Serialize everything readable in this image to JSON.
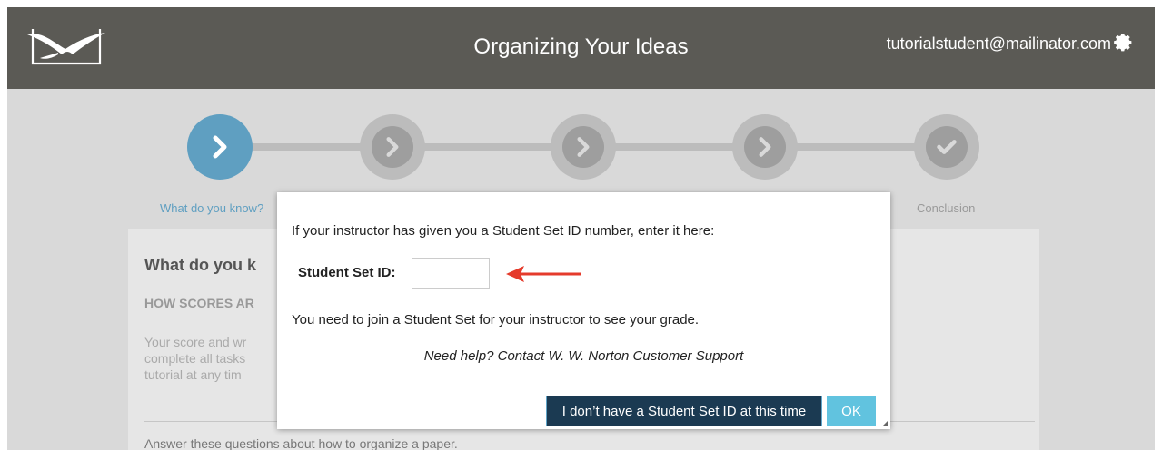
{
  "header": {
    "title": "Organizing Your Ideas",
    "user_email": "tutorialstudent@mailinator.com",
    "logo": "seagull-logo",
    "settings_icon": "gear-icon"
  },
  "progress": {
    "steps": [
      {
        "label": "What do you know?",
        "state": "active",
        "icon": "chevron-right-icon"
      },
      {
        "label": "",
        "state": "inactive",
        "icon": "chevron-right-icon"
      },
      {
        "label": "",
        "state": "inactive",
        "icon": "chevron-right-icon"
      },
      {
        "label": "",
        "state": "inactive",
        "icon": "chevron-right-icon"
      },
      {
        "label": "Conclusion",
        "state": "inactive",
        "icon": "check-icon"
      }
    ]
  },
  "card": {
    "heading": "What do you k",
    "subheading": "HOW SCORES AR",
    "body": "Your score and wr complete all tasks tutorial at any tim",
    "footer": "Answer these questions about how to organize a paper."
  },
  "modal": {
    "prompt": "If your instructor has given you a Student Set ID number, enter it here:",
    "field_label": "Student Set ID:",
    "field_value": "",
    "note": "You need to join a Student Set for your instructor to see your grade.",
    "help": "Need help? Contact W. W. Norton Customer Support",
    "no_id_button": "I don’t have a Student Set ID at this time",
    "ok_button": "OK"
  },
  "colors": {
    "header_bg": "#5b5a55",
    "active_step": "#5f9fc1",
    "primary_button": "#1b3a52",
    "ok_button": "#61c3df",
    "arrow": "#e53b2c"
  }
}
